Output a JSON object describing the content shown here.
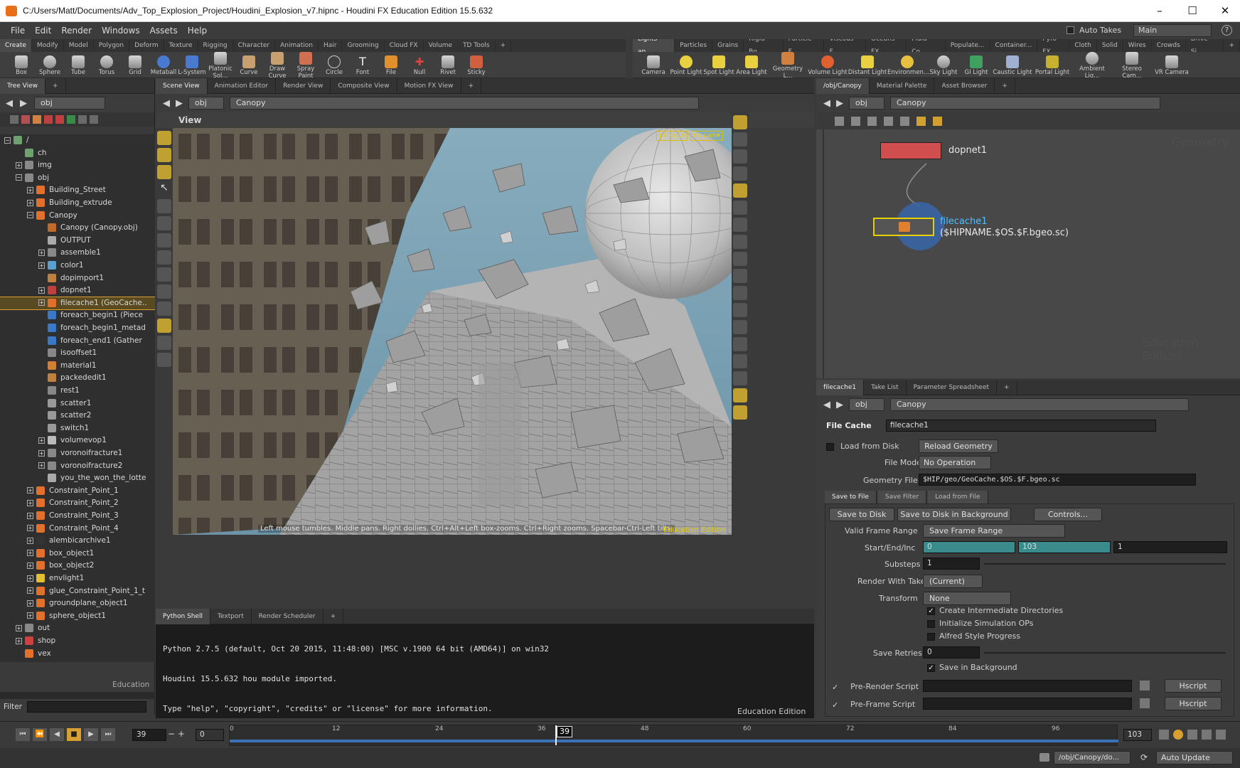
{
  "window": {
    "title": "C:/Users/Matt/Documents/Adv_Top_Explosion_Project/Houdini_Explosion_v7.hipnc - Houdini FX Education Edition 15.5.632",
    "minimize": "–",
    "maximize": "☐",
    "close": "✕"
  },
  "menu": [
    "File",
    "Edit",
    "Render",
    "Windows",
    "Assets",
    "Help"
  ],
  "header_right": {
    "auto_takes": "Auto Takes",
    "desktop": "Main"
  },
  "shelf_tabs_left": [
    "Create",
    "Modify",
    "Model",
    "Polygon",
    "Deform",
    "Texture",
    "Rigging",
    "Character",
    "Animation",
    "Hair",
    "Grooming",
    "Cloud FX",
    "Volume",
    "TD Tools",
    "+"
  ],
  "shelf_tools_left": [
    "Box",
    "Sphere",
    "Tube",
    "Torus",
    "Grid",
    "Metaball",
    "L-System",
    "Platonic Sol...",
    "Curve",
    "Draw Curve",
    "Spray Paint",
    "Circle",
    "Font",
    "File",
    "Null",
    "Rivet",
    "Sticky"
  ],
  "shelf_tabs_right": [
    "Lights an...",
    "Particles",
    "Grains",
    "Rigid Bo...",
    "Particle F...",
    "Viscous F...",
    "Oceans FX",
    "Fluid Co...",
    "Populate...",
    "Container...",
    "Pyro FX",
    "Cloth",
    "Solid",
    "Wires",
    "Crowds",
    "Drive Si...",
    "+"
  ],
  "shelf_tools_right": [
    "Camera",
    "Point Light",
    "Spot Light",
    "Area Light",
    "Geometry L...",
    "Volume Light",
    "Distant Light",
    "Environmen...",
    "Sky Light",
    "GI Light",
    "Caustic Light",
    "Portal Light",
    "Ambient Lig...",
    "Stereo Cam...",
    "VR Camera"
  ],
  "tree": {
    "tab": "Tree View",
    "path": "obj",
    "footer": "Education",
    "filter_label": "Filter",
    "items": [
      {
        "label": "/",
        "depth": 0,
        "exp": "−",
        "color": "#6fa06f"
      },
      {
        "label": "ch",
        "depth": 1,
        "exp": "",
        "color": "#6fa06f"
      },
      {
        "label": "img",
        "depth": 1,
        "exp": "+",
        "color": "#888"
      },
      {
        "label": "obj",
        "depth": 1,
        "exp": "−",
        "color": "#888"
      },
      {
        "label": "Building_Street",
        "depth": 2,
        "exp": "+",
        "color": "#e0702c"
      },
      {
        "label": "Building_extrude",
        "depth": 2,
        "exp": "+",
        "color": "#e0702c"
      },
      {
        "label": "Canopy",
        "depth": 2,
        "exp": "−",
        "color": "#e0702c"
      },
      {
        "label": "Canopy (Canopy.obj)",
        "depth": 3,
        "exp": "",
        "color": "#c06a2a"
      },
      {
        "label": "OUTPUT",
        "depth": 3,
        "exp": "",
        "color": "#aaa"
      },
      {
        "label": "assemble1",
        "depth": 3,
        "exp": "+",
        "color": "#888"
      },
      {
        "label": "color1",
        "depth": 3,
        "exp": "+",
        "color": "#5aa0d0"
      },
      {
        "label": "dopimport1",
        "depth": 3,
        "exp": "",
        "color": "#c08040"
      },
      {
        "label": "dopnet1",
        "depth": 3,
        "exp": "+",
        "color": "#c04040"
      },
      {
        "label": "filecache1 (GeoCache..",
        "depth": 3,
        "exp": "+",
        "color": "#e0702c",
        "sel": true
      },
      {
        "label": "foreach_begin1 (Piece",
        "depth": 3,
        "exp": "",
        "color": "#3a78c8"
      },
      {
        "label": "foreach_begin1_metad",
        "depth": 3,
        "exp": "",
        "color": "#3a78c8"
      },
      {
        "label": "foreach_end1 (Gather",
        "depth": 3,
        "exp": "",
        "color": "#3a78c8"
      },
      {
        "label": "isooffset1",
        "depth": 3,
        "exp": "",
        "color": "#888"
      },
      {
        "label": "material1",
        "depth": 3,
        "exp": "",
        "color": "#d08030"
      },
      {
        "label": "packededit1",
        "depth": 3,
        "exp": "",
        "color": "#c08040"
      },
      {
        "label": "rest1",
        "depth": 3,
        "exp": "",
        "color": "#888"
      },
      {
        "label": "scatter1",
        "depth": 3,
        "exp": "",
        "color": "#999"
      },
      {
        "label": "scatter2",
        "depth": 3,
        "exp": "",
        "color": "#999"
      },
      {
        "label": "switch1",
        "depth": 3,
        "exp": "",
        "color": "#999"
      },
      {
        "label": "volumevop1",
        "depth": 3,
        "exp": "+",
        "color": "#bbb"
      },
      {
        "label": "voronoifracture1",
        "depth": 3,
        "exp": "+",
        "color": "#888"
      },
      {
        "label": "voronoifracture2",
        "depth": 3,
        "exp": "+",
        "color": "#888"
      },
      {
        "label": "you_the_won_the_lotte",
        "depth": 3,
        "exp": "",
        "color": "#aaa"
      },
      {
        "label": "Constraint_Point_1",
        "depth": 2,
        "exp": "+",
        "color": "#e0702c"
      },
      {
        "label": "Constraint_Point_2",
        "depth": 2,
        "exp": "+",
        "color": "#e0702c"
      },
      {
        "label": "Constraint_Point_3",
        "depth": 2,
        "exp": "+",
        "color": "#e0702c"
      },
      {
        "label": "Constraint_Point_4",
        "depth": 2,
        "exp": "+",
        "color": "#e0702c"
      },
      {
        "label": "alembicarchive1",
        "depth": 2,
        "exp": "+",
        "color": "#333"
      },
      {
        "label": "box_object1",
        "depth": 2,
        "exp": "+",
        "color": "#e0702c"
      },
      {
        "label": "box_object2",
        "depth": 2,
        "exp": "+",
        "color": "#e0702c"
      },
      {
        "label": "envlight1",
        "depth": 2,
        "exp": "+",
        "color": "#e0c030"
      },
      {
        "label": "glue_Constraint_Point_1_t",
        "depth": 2,
        "exp": "+",
        "color": "#e0702c"
      },
      {
        "label": "groundplane_object1",
        "depth": 2,
        "exp": "+",
        "color": "#e0702c"
      },
      {
        "label": "sphere_object1",
        "depth": 2,
        "exp": "+",
        "color": "#e0702c"
      },
      {
        "label": "out",
        "depth": 1,
        "exp": "+",
        "color": "#888"
      },
      {
        "label": "shop",
        "depth": 1,
        "exp": "+",
        "color": "#d04040"
      },
      {
        "label": "vex",
        "depth": 1,
        "exp": "",
        "color": "#e0702c"
      }
    ]
  },
  "viewer": {
    "tabs": [
      "Scene View",
      "Animation Editor",
      "Render View",
      "Composite View",
      "Motion FX View",
      "+"
    ],
    "path": [
      "obj",
      "Canopy"
    ],
    "title": "View",
    "cam1": "persp1▾",
    "cam2": "no cam▾",
    "hint": "Left mouse tumbles. Middle pans. Right dollies. Ctrl+Alt+Left box-zooms. Ctrl+Right zooms. Spacebar-Ctrl-Left tilts.",
    "watermark": "Education Edition"
  },
  "shell": {
    "tabs": [
      "Python Shell",
      "Textport",
      "Render Scheduler",
      "+"
    ],
    "lines": [
      "Python 2.7.5 (default, Oct 20 2015, 11:48:00) [MSC v.1900 64 bit (AMD64)] on win32",
      "Houdini 15.5.632 hou module imported.",
      "Type \"help\", \"copyright\", \"credits\" or \"license\" for more information.",
      ">>>"
    ],
    "watermark": "Education Edition"
  },
  "network": {
    "tabs": [
      "/obj/Canopy",
      "Material Palette",
      "Asset Browser",
      "+"
    ],
    "path": [
      "obj",
      "Canopy"
    ],
    "node1": "dopnet1",
    "node2": "filecache1",
    "node2_sub": "($HIPNAME.$OS.$F.bgeo.sc)",
    "corner": "Geometry",
    "watermark": "Education Edition"
  },
  "params": {
    "tabs": [
      "filecache1",
      "Take List",
      "Parameter Spreadsheet",
      "+"
    ],
    "path": [
      "obj",
      "Canopy"
    ],
    "type": "File Cache",
    "name": "filecache1",
    "load_from_disk": "Load from Disk",
    "reload": "Reload Geometry",
    "file_mode_label": "File Mode",
    "file_mode": "No Operation",
    "geo_file_label": "Geometry File",
    "geo_file": "$HIP/geo/GeoCache.$OS.$F.bgeo.sc",
    "subtabs": [
      "Save to File",
      "Save Filter",
      "Load from File"
    ],
    "save_disk": "Save to Disk",
    "save_bg": "Save to Disk in Background",
    "controls": "Controls...",
    "vfr_label": "Valid Frame Range",
    "vfr": "Save Frame Range",
    "sei_label": "Start/End/Inc",
    "start": "0",
    "end": "103",
    "inc": "1",
    "substeps_label": "Substeps",
    "substeps": "1",
    "take_label": "Render With Take",
    "take": "(Current)",
    "transform_label": "Transform",
    "transform": "None",
    "cid": "Create Intermediate Directories",
    "iso": "Initialize Simulation OPs",
    "asp": "Alfred Style Progress",
    "retries_label": "Save Retries",
    "retries": "0",
    "sib": "Save in Background",
    "prs": "Pre-Render Script",
    "pfs": "Pre-Frame Script",
    "hscript": "Hscript"
  },
  "timeline": {
    "frame": "39",
    "start": "0",
    "end": "103",
    "current": "39",
    "ticks": [
      "0",
      "12",
      "24",
      "36",
      "48",
      "60",
      "72",
      "84",
      "96"
    ]
  },
  "status": {
    "path": "/obj/Canopy/do...",
    "update": "Auto Update"
  }
}
